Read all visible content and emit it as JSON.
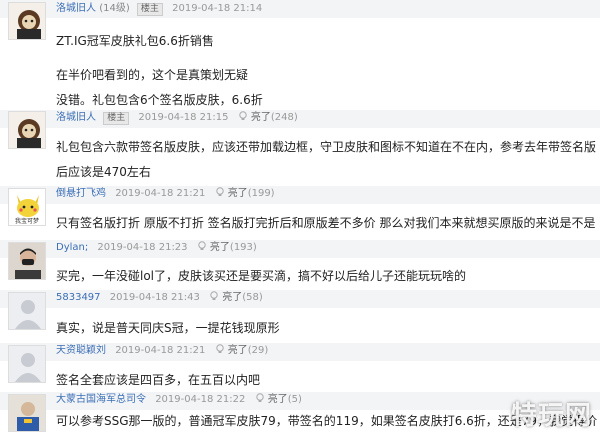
{
  "posts": [
    {
      "user": "洛城旧人",
      "level": "(14级)",
      "badge": "楼主",
      "time": "2019-04-18 21:14",
      "lines": [
        "ZT.IG冠军皮肤礼包6.6折销售",
        "在半价吧看到的，这个是真策划无疑",
        "没错。礼包包含6个签名版皮肤，6.6折"
      ]
    },
    {
      "user": "洛城旧人",
      "badge": "楼主",
      "time": "2019-04-18 21:15",
      "like_label": "亮了",
      "like_count": "(248)",
      "lines": [
        "礼包包含六款带签名版皮肤，应该还带加载边框，守卫皮肤和图标不知道在不在内，参考去年带签名版",
        "后应该是470左右"
      ]
    },
    {
      "user": "倒悬打飞鸡",
      "time": "2019-04-18 21:21",
      "like_label": "亮了",
      "like_count": "(199)",
      "lines": [
        "只有签名版打折 原版不打折 签名版打完折后和原版差不多价 那么对我们本来就想买原版的来说是不是"
      ]
    },
    {
      "user": "Dylan;",
      "time": "2019-04-18 21:23",
      "like_label": "亮了",
      "like_count": "(193)",
      "lines": [
        "买完，一年没碰lol了，皮肤该买还是要买滴，搞不好以后给儿子还能玩玩啥的"
      ]
    },
    {
      "user": "5833497",
      "time": "2019-04-18 21:43",
      "like_label": "亮了",
      "like_count": "(58)",
      "lines": [
        "真实，说是普天同庆S冠，一提花钱现原形"
      ]
    },
    {
      "user": "天资聪颖刘",
      "time": "2019-04-18 21:21",
      "like_label": "亮了",
      "like_count": "(29)",
      "lines": [
        "签名全套应该是四百多，在五百以内吧"
      ]
    },
    {
      "user": "大蒙古国海军总司令",
      "time": "2019-04-18 21:22",
      "like_label": "亮了",
      "like_count": "(5)",
      "lines": [
        "可以参考SSG那一版的，普通冠军皮肤79，带签名的119，如果签名皮肤打6.6折，还是79，我觉得价"
      ]
    }
  ],
  "avatar_texts": {
    "post3_caption": "我宝可梦"
  },
  "watermark": "特玩网",
  "colors": {
    "username": "#3b6fb6",
    "header_bg": "#f3f4f6",
    "meta_gray": "#999999"
  },
  "icons": [
    "lamp-icon",
    "avatar"
  ]
}
